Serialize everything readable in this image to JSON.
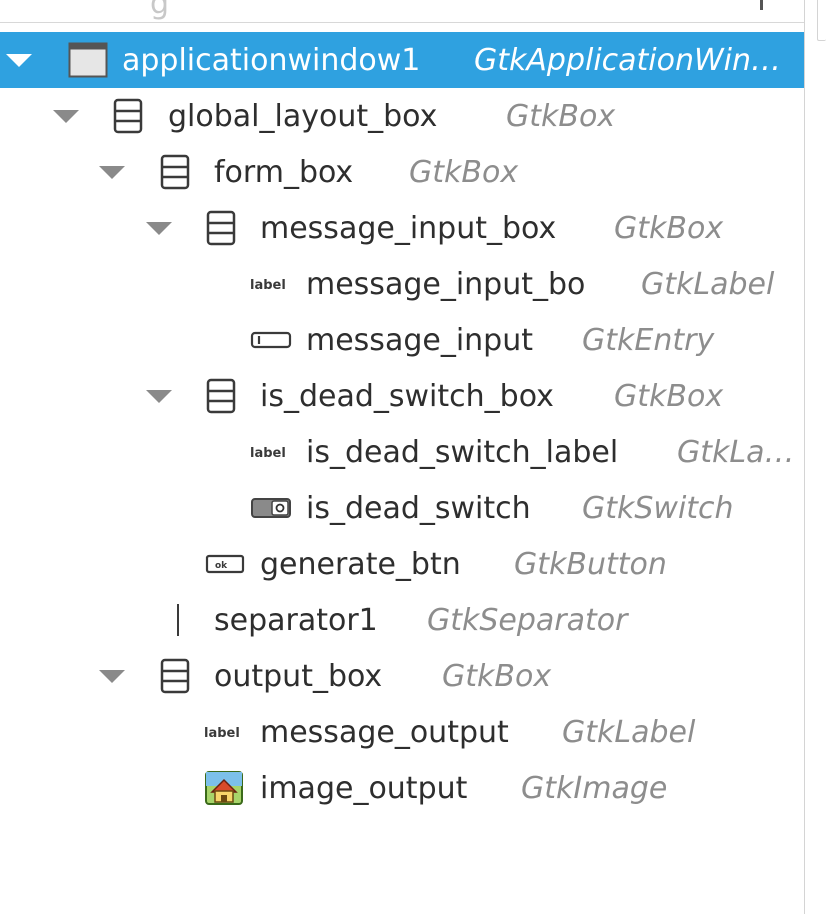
{
  "search": {
    "placeholder": "g"
  },
  "tree": {
    "rows": [
      {
        "name": "applicationwindow1",
        "type": "GtkApplicationWin…",
        "icon": "window-icon",
        "expanded": true,
        "selected": true
      },
      {
        "name": "global_layout_box",
        "type": "GtkBox",
        "icon": "box-icon",
        "expanded": true,
        "selected": false
      },
      {
        "name": "form_box",
        "type": "GtkBox",
        "icon": "box-icon",
        "expanded": true,
        "selected": false
      },
      {
        "name": "message_input_box",
        "type": "GtkBox",
        "icon": "box-icon",
        "expanded": true,
        "selected": false
      },
      {
        "name": "message_input_bo",
        "type": "GtkLabel",
        "icon": "label-icon",
        "expanded": null,
        "selected": false
      },
      {
        "name": "message_input",
        "type": "GtkEntry",
        "icon": "entry-icon",
        "expanded": null,
        "selected": false
      },
      {
        "name": "is_dead_switch_box",
        "type": "GtkBox",
        "icon": "box-icon",
        "expanded": true,
        "selected": false
      },
      {
        "name": "is_dead_switch_label",
        "type": "GtkLa…",
        "icon": "label-icon",
        "expanded": null,
        "selected": false
      },
      {
        "name": "is_dead_switch",
        "type": "GtkSwitch",
        "icon": "switch-icon",
        "expanded": null,
        "selected": false
      },
      {
        "name": "generate_btn",
        "type": "GtkButton",
        "icon": "button-icon",
        "expanded": null,
        "selected": false
      },
      {
        "name": "separator1",
        "type": "GtkSeparator",
        "icon": "separator-icon",
        "expanded": null,
        "selected": false
      },
      {
        "name": "output_box",
        "type": "GtkBox",
        "icon": "box-icon",
        "expanded": true,
        "selected": false
      },
      {
        "name": "message_output",
        "type": "GtkLabel",
        "icon": "label-icon",
        "expanded": null,
        "selected": false
      },
      {
        "name": "image_output",
        "type": "GtkImage",
        "icon": "image-icon",
        "expanded": null,
        "selected": false
      }
    ],
    "icon_label_text": "label",
    "icon_button_text": "ok"
  },
  "colors": {
    "selection": "#2fa1e0",
    "name_text": "#2e2e2e",
    "type_text": "#8d8d8d",
    "expander": "#8a8a8a"
  }
}
